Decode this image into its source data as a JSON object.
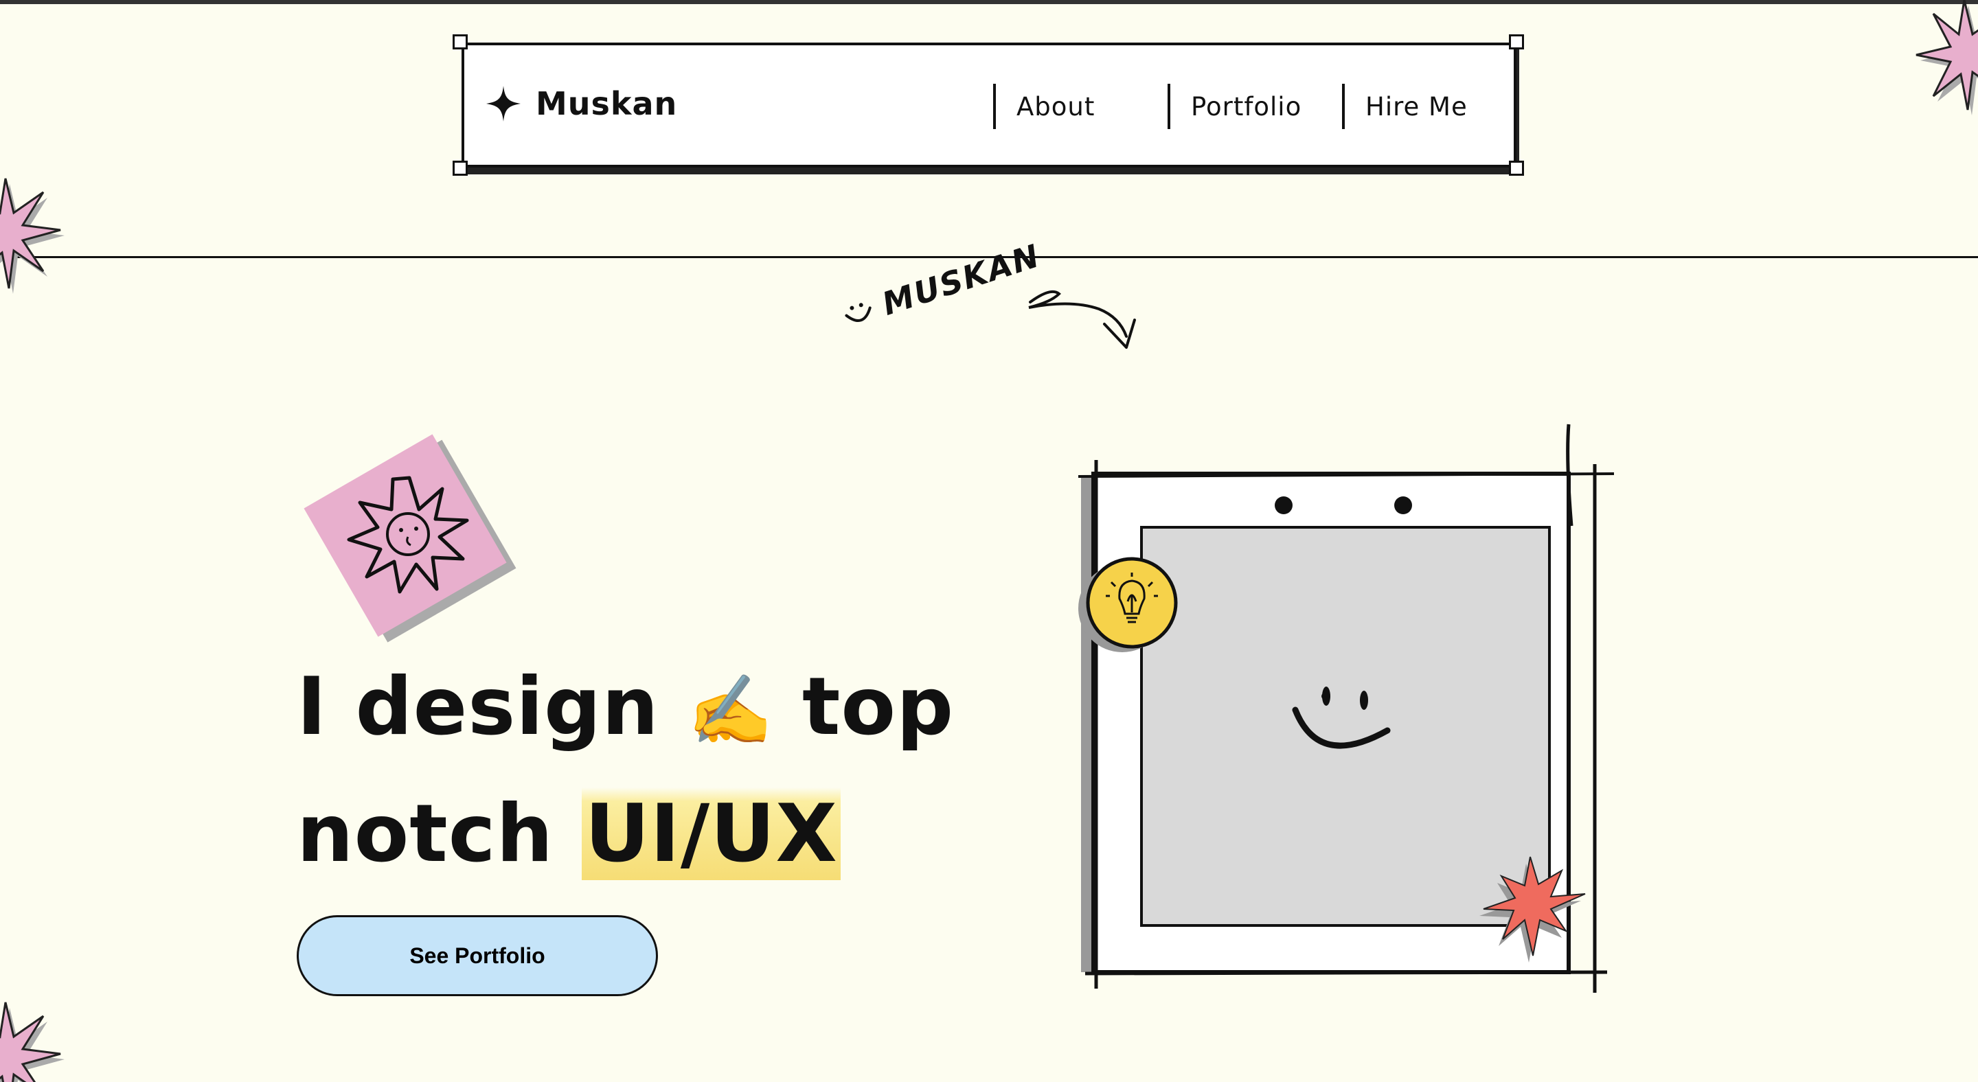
{
  "nav": {
    "brand": "Muskan",
    "links": [
      "About",
      "Portfolio",
      "Hire Me"
    ]
  },
  "tag": {
    "text": "MUSKAN"
  },
  "hero": {
    "line1_a": "I design",
    "emoji": "✍️",
    "line1_b": "top",
    "line2_a": "notch",
    "line2_highlight": "UI/UX",
    "cta": "See Portfolio"
  },
  "colors": {
    "background": "#fdfdf0",
    "pink": "#e8afcd",
    "highlight": "#f6dd75",
    "button": "#c5e4f9",
    "coral": "#ef6b5e",
    "bulb": "#f6d24a"
  },
  "icons": [
    "sparkle-icon",
    "smiley-icon",
    "arrow-icon",
    "sun-icon",
    "lightbulb-icon",
    "star-icon"
  ]
}
